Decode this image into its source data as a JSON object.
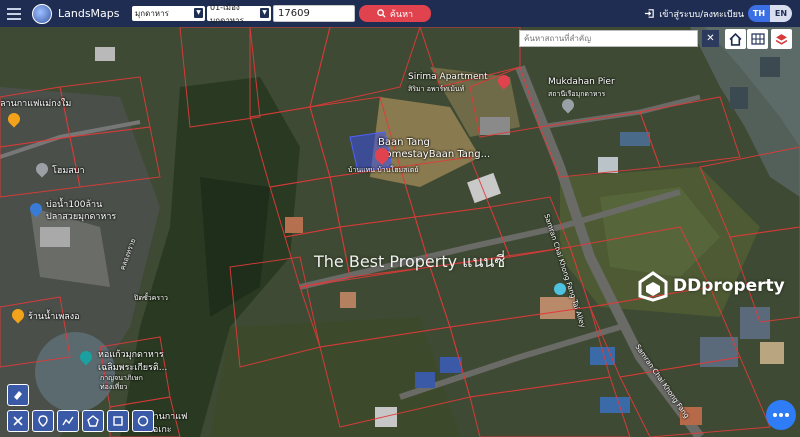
{
  "header": {
    "brand": "LandsMaps",
    "province_select": "มุกดาหาร",
    "district_select": "01-เมืองมุกดาหาร",
    "parcel_value": "17609",
    "search_label": "ค้นหา",
    "login_label": "เข้าสู่ระบบ/ลงทะเบียน",
    "lang_th": "TH",
    "lang_en": "EN"
  },
  "map_search": {
    "placeholder": "ค้นหาสถานที่สำคัญ",
    "clear": "✕"
  },
  "map_labels": {
    "cafe": "ลานกาแฟแม่กงใม",
    "homsaba": "โฮมสบา",
    "bo_nam": "บ่อน้ำ100ล้าน",
    "bo_nam_sub": "ปลาสวยมุกดาหาร",
    "khlong": "คลองทราย",
    "pichet": "ปิดซั้วคราว",
    "rannam": "ร้านน้ำเพลงอ",
    "tower": "หอแก้วมุกดาหาร",
    "tower_sub": "เฉลิมพระเกียรติ...",
    "tower_sub2": "กาญจนาภิเษก",
    "tower_sub3": "ท่องเที่ยว",
    "cafe2": "ลานกาแฟ",
    "cafe2_sub": "โอเกะ",
    "sirima": "Sirima Apartment",
    "sirima_sub": "สิริมา อพาร์ทเม้นท์",
    "pier": "Mukdahan Pier",
    "pier_sub": "สถานีเรือมุกดาหาร",
    "baan_tang": "Baan Tang",
    "baan_tang2": "HomestayBaan Tang...",
    "baan_tang_sub": "บ้านแทน บ้านโฮมสเตย์",
    "road1": "Samran Chai Khong Fang Tai Alley",
    "road2": "Samran Chai Khong Fang"
  },
  "watermark": {
    "text": "The Best Property แนนซี่",
    "ddproperty": "DDproperty"
  },
  "colors": {
    "topbar": "#1f2d52",
    "search_button": "#e0434d",
    "parcel_lines": "#e23a3a",
    "fab": "#2e7cf6"
  }
}
